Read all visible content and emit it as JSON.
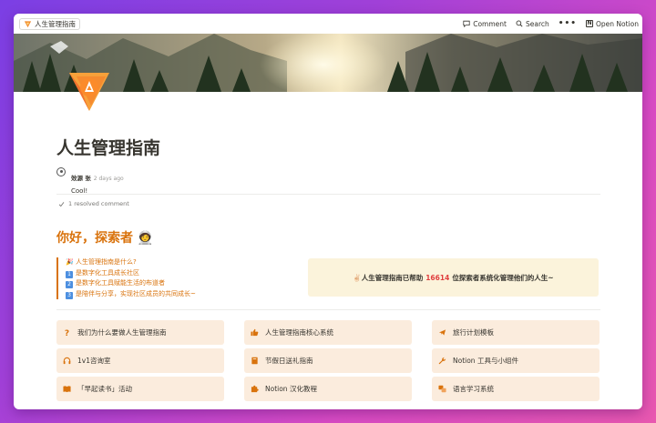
{
  "topbar": {
    "breadcrumb": "人生管理指南",
    "comment_label": "Comment",
    "search_label": "Search",
    "more_label": "•••",
    "open_label": "Open Notion"
  },
  "page": {
    "title": "人生管理指南"
  },
  "comment": {
    "author": "效源 张",
    "time": "2 days ago",
    "text": "Cool!"
  },
  "resolved_label": "1 resolved comment",
  "greeting": "你好，探索者 🧑‍🚀",
  "intro_list": [
    {
      "marker": "🎉",
      "text": "人生管理指南是什么?"
    },
    {
      "marker": "1",
      "text": "是数字化工具成长社区"
    },
    {
      "marker": "2",
      "text": "是数字化工具赋能生活的布道者"
    },
    {
      "marker": "3",
      "text": "是陪伴与分享，实现社区成员的共同成长~"
    }
  ],
  "callout": {
    "emoji": "✌🏻",
    "prefix": "人生管理指南已帮助",
    "count": "16614",
    "suffix": "位探索者系统化管理他们的人生~"
  },
  "cards": [
    {
      "icon": "question-icon",
      "label": "我们为什么要做人生管理指南"
    },
    {
      "icon": "thumbs-up-icon",
      "label": "人生管理指南核心系统"
    },
    {
      "icon": "plane-icon",
      "label": "旅行计划模板"
    },
    {
      "icon": "headphones-icon",
      "label": "1v1咨询室"
    },
    {
      "icon": "book-icon",
      "label": "节假日送礼指南"
    },
    {
      "icon": "wrench-icon",
      "label": "Notion 工具与小组件"
    },
    {
      "icon": "open-book-icon",
      "label": "「早起读书」活动"
    },
    {
      "icon": "puzzle-icon",
      "label": "Notion 汉化教程"
    },
    {
      "icon": "language-icon",
      "label": "语言学习系统"
    }
  ],
  "colors": {
    "accent_orange": "#d9730d",
    "card_bg": "#fbecdd",
    "callout_bg": "#fbf3db",
    "count_red": "#e03e3e",
    "number_blue": "#4c8fe0"
  }
}
